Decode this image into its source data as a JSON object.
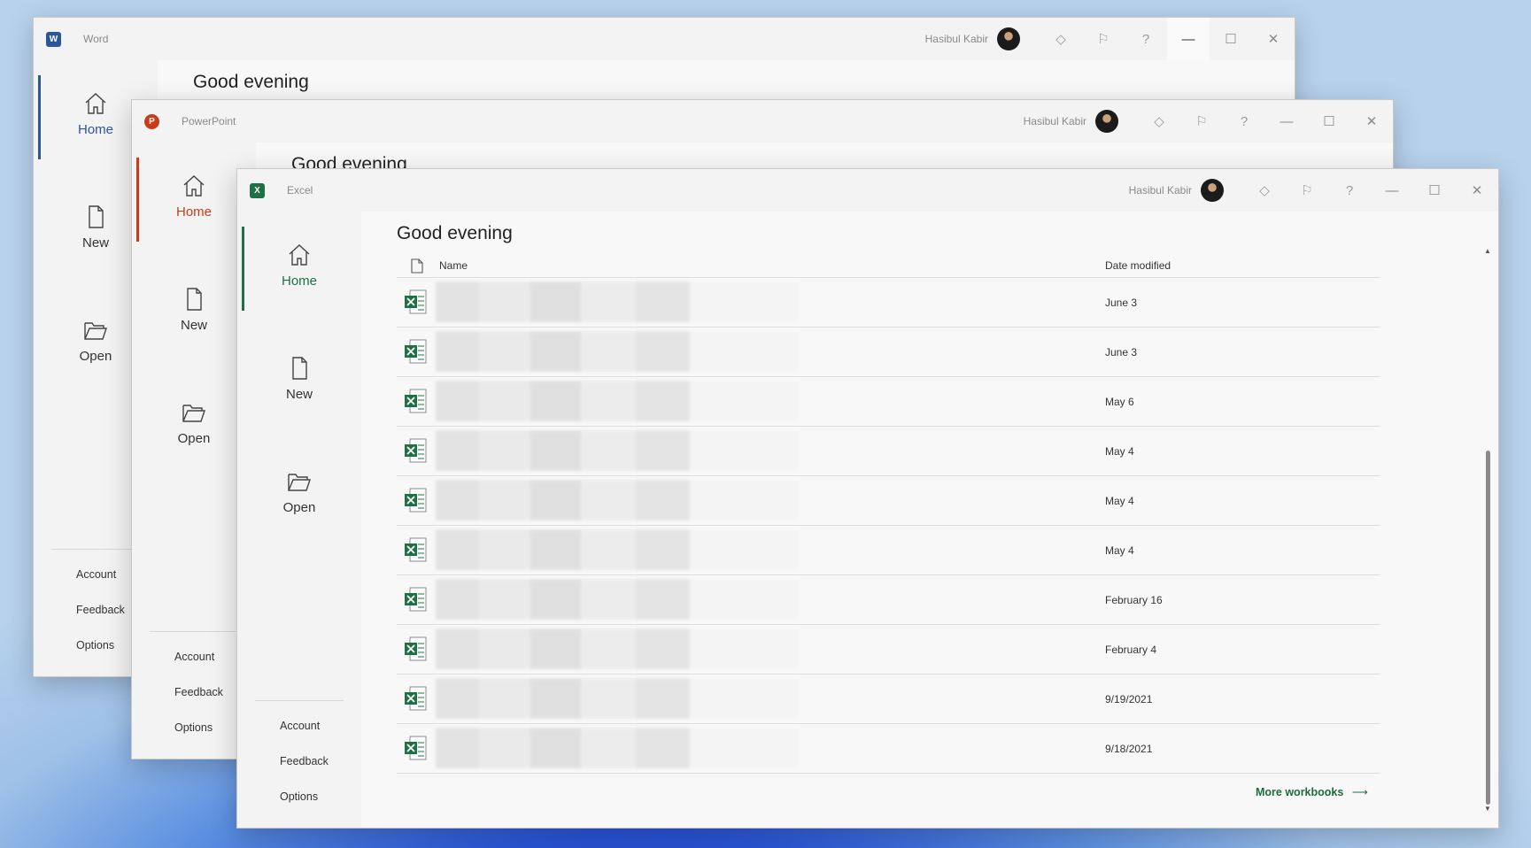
{
  "colors": {
    "word": "#2b579a",
    "powerpoint": "#c43e1c",
    "excel": "#1e7145"
  },
  "user_name": "Hasibul Kabir",
  "word": {
    "app_name": "Word",
    "greeting": "Good evening",
    "nav": {
      "home": "Home",
      "new": "New",
      "open": "Open"
    },
    "footer": {
      "account": "Account",
      "feedback": "Feedback",
      "options": "Options"
    }
  },
  "powerpoint": {
    "app_name": "PowerPoint",
    "greeting": "Good evening",
    "nav": {
      "home": "Home",
      "new": "New",
      "open": "Open"
    },
    "footer": {
      "account": "Account",
      "feedback": "Feedback",
      "options": "Options"
    }
  },
  "excel": {
    "app_name": "Excel",
    "greeting": "Good evening",
    "nav": {
      "home": "Home",
      "new": "New",
      "open": "Open"
    },
    "footer": {
      "account": "Account",
      "feedback": "Feedback",
      "options": "Options"
    },
    "columns": {
      "name": "Name",
      "date": "Date modified"
    },
    "files": [
      {
        "date": "June 3"
      },
      {
        "date": "June 3"
      },
      {
        "date": "May 6"
      },
      {
        "date": "May 4"
      },
      {
        "date": "May 4"
      },
      {
        "date": "May 4"
      },
      {
        "date": "February 16"
      },
      {
        "date": "February 4"
      },
      {
        "date": "9/19/2021"
      },
      {
        "date": "9/18/2021"
      }
    ],
    "more_workbooks": "More workbooks"
  },
  "icons": {
    "home": "home-icon",
    "new": "new-document-icon",
    "open": "open-folder-icon",
    "premium": "diamond-icon",
    "coauthor": "coauthoring-icon",
    "help": "help-icon",
    "minimize": "minimize-icon",
    "maximize": "maximize-icon",
    "close": "close-icon",
    "file": "excel-file-icon",
    "arrow": "arrow-right-icon"
  }
}
